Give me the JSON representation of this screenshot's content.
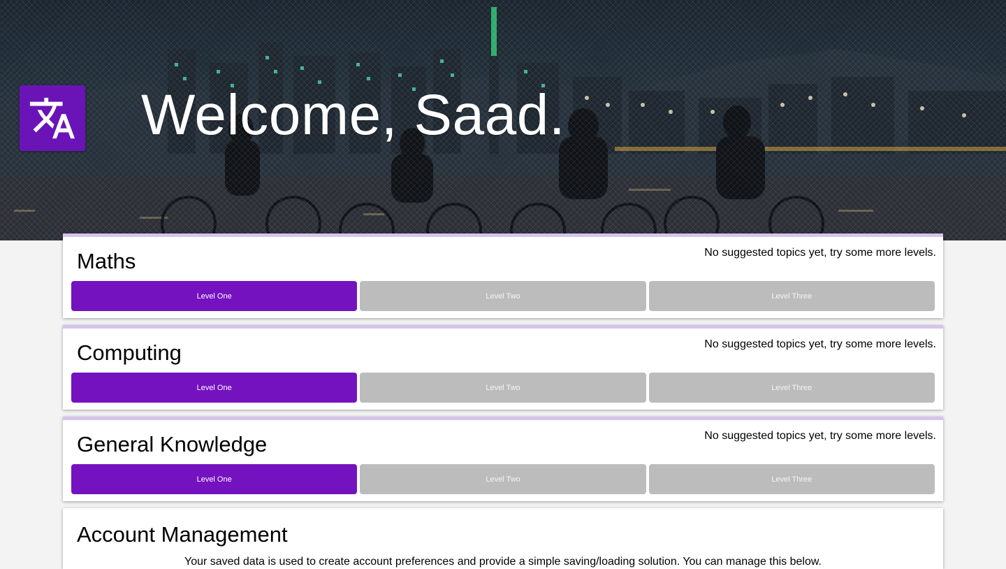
{
  "app": {
    "welcome_text": "Welcome, Saad.",
    "logo_icon": "translate-icon",
    "accent_color": "#7412c0",
    "locked_color": "#bcbcbc"
  },
  "subjects": [
    {
      "title": "Maths",
      "note": "No suggested topics yet, try some more levels.",
      "levels": [
        {
          "label": "Level One",
          "state": "active"
        },
        {
          "label": "Level Two",
          "state": "locked"
        },
        {
          "label": "Level Three",
          "state": "locked"
        }
      ]
    },
    {
      "title": "Computing",
      "note": "No suggested topics yet, try some more levels.",
      "levels": [
        {
          "label": "Level One",
          "state": "active"
        },
        {
          "label": "Level Two",
          "state": "locked"
        },
        {
          "label": "Level Three",
          "state": "locked"
        }
      ]
    },
    {
      "title": "General Knowledge",
      "note": "No suggested topics yet, try some more levels.",
      "levels": [
        {
          "label": "Level One",
          "state": "active"
        },
        {
          "label": "Level Two",
          "state": "locked"
        },
        {
          "label": "Level Three",
          "state": "locked"
        }
      ]
    }
  ],
  "account": {
    "title": "Account Management",
    "description": "Your saved data is used to create account preferences and provide a simple saving/loading solution. You can manage this below."
  }
}
